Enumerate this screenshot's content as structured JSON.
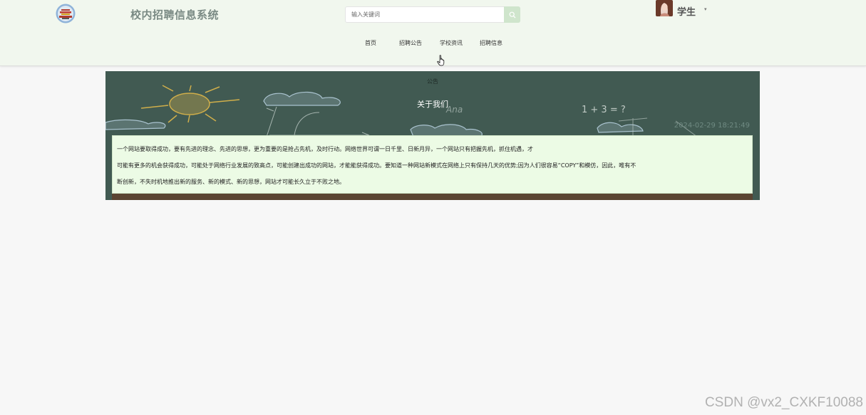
{
  "header": {
    "site_title": "校内招聘信息系统",
    "search": {
      "placeholder": "输入关键词",
      "value": ""
    },
    "user": {
      "name": "学生",
      "caret": "▾"
    }
  },
  "nav": {
    "items": [
      {
        "label": "首页"
      },
      {
        "label": "招聘公告"
      },
      {
        "label": "学校资讯"
      },
      {
        "label": "招聘信息"
      }
    ]
  },
  "notice": {
    "breadcrumb": "公告",
    "title": "关于我们",
    "date": "2024-02-29 18:21:49",
    "content_lines": [
      "一个网站要取得成功，要有先进的理念、先进的思想，更为重要的是抢占先机，及时行动。网络世界可谓一日千里、日新月异，一个网站只有把握先机，抓住机遇，才",
      "可能有更多的机会获得成功，可能处于网络行业发展的致高点，可能创建出成功的网站，才能能获得成功。要知道一种网站新模式在网络上只有保持几天的优势;因为人们很容易“COPY”和模仿，因此，唯有不",
      "断创新，不失时机地推出新的服务、新的模式、新的思想，网站才可能长久立于不败之地。"
    ]
  },
  "watermark": "CSDN @vx2_CXKF10088",
  "colors": {
    "header_bg": "#f1f7ee",
    "board_bg": "#415a52",
    "content_bg": "#ecfbe5",
    "search_btn": "#cfe5cc"
  },
  "icons": {
    "logo": "temple-emblem-icon",
    "search": "search-icon",
    "cursor": "hand-pointer-icon"
  }
}
